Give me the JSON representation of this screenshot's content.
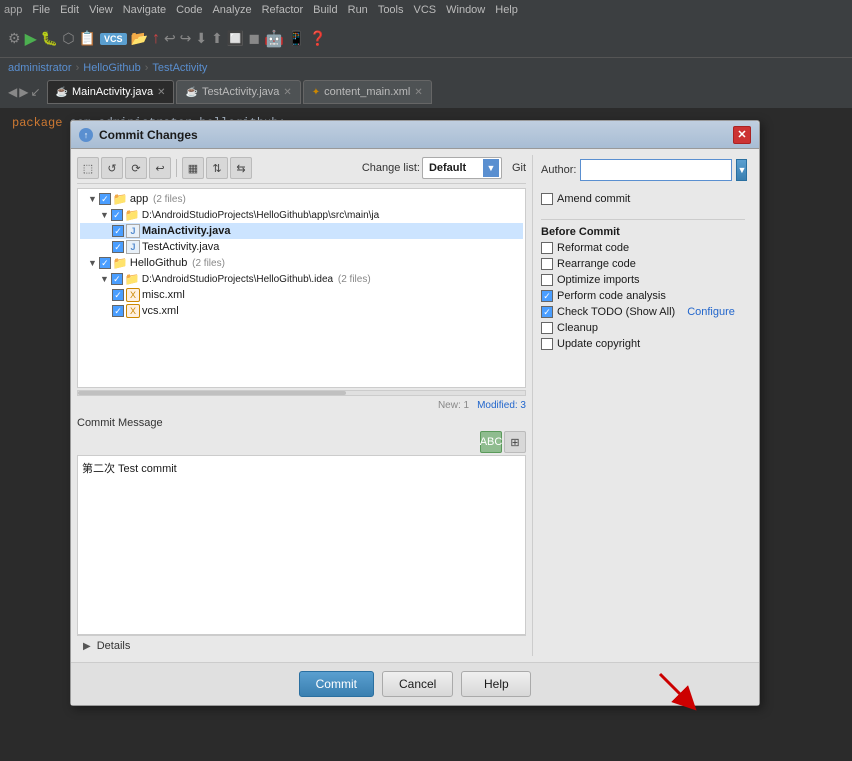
{
  "ide": {
    "menu_items": [
      "app",
      "File",
      "Edit",
      "View",
      "Navigate",
      "Code",
      "Analyze",
      "Refactor",
      "Build",
      "Run",
      "Tools",
      "VCS",
      "Window",
      "Help"
    ],
    "breadcrumbs": [
      "administrator",
      "HelloGithub",
      "TestActivity"
    ],
    "tabs": [
      {
        "label": "MainActivity.java",
        "active": true,
        "icon": "java"
      },
      {
        "label": "TestActivity.java",
        "active": false,
        "icon": "java"
      },
      {
        "label": "content_main.xml",
        "active": false,
        "icon": "xml"
      }
    ],
    "editor_code": "package com.administrator.hellogithub;"
  },
  "dialog": {
    "title": "Commit Changes",
    "toolbar": {
      "changelist_label": "Change list:",
      "changelist_value": "Default",
      "git_label": "Git"
    },
    "file_tree": [
      {
        "indent": 1,
        "type": "folder",
        "checked": true,
        "label": "app",
        "meta": "(2 files)",
        "expanded": true
      },
      {
        "indent": 2,
        "type": "folder_path",
        "checked": true,
        "label": "D:\\AndroidStudioProjects\\HelloGithub\\app\\src\\main\\ja",
        "expanded": true
      },
      {
        "indent": 3,
        "type": "java",
        "checked": true,
        "label": "MainActivity.java",
        "highlighted": true
      },
      {
        "indent": 3,
        "type": "java",
        "checked": true,
        "label": "TestActivity.java"
      },
      {
        "indent": 1,
        "type": "folder",
        "checked": true,
        "label": "HelloGithub",
        "meta": "(2 files)",
        "expanded": true
      },
      {
        "indent": 2,
        "type": "folder_path",
        "checked": true,
        "label": "D:\\AndroidStudioProjects\\HelloGithub\\.idea",
        "meta": "(2 files)",
        "expanded": true
      },
      {
        "indent": 3,
        "type": "xml",
        "checked": true,
        "label": "misc.xml"
      },
      {
        "indent": 3,
        "type": "xml",
        "checked": true,
        "label": "vcs.xml"
      }
    ],
    "status": {
      "new_label": "New: 1",
      "modified_label": "Modified: 3"
    },
    "commit_message": {
      "label": "Commit Message",
      "value": "第二次 Test commit"
    },
    "details_label": "Details",
    "git_panel": {
      "author_label": "Author:",
      "author_placeholder": "",
      "amend_label": "Amend commit",
      "before_commit_label": "Before Commit",
      "options": [
        {
          "label": "Reformat code",
          "checked": false
        },
        {
          "label": "Rearrange code",
          "checked": false
        },
        {
          "label": "Optimize imports",
          "checked": false
        },
        {
          "label": "Perform code analysis",
          "checked": true
        },
        {
          "label": "Check TODO (Show All)",
          "checked": true,
          "extra": "Configure"
        },
        {
          "label": "Cleanup",
          "checked": false
        },
        {
          "label": "Update copyright",
          "checked": false
        }
      ]
    },
    "buttons": {
      "commit": "Commit",
      "cancel": "Cancel",
      "help": "Help"
    }
  }
}
